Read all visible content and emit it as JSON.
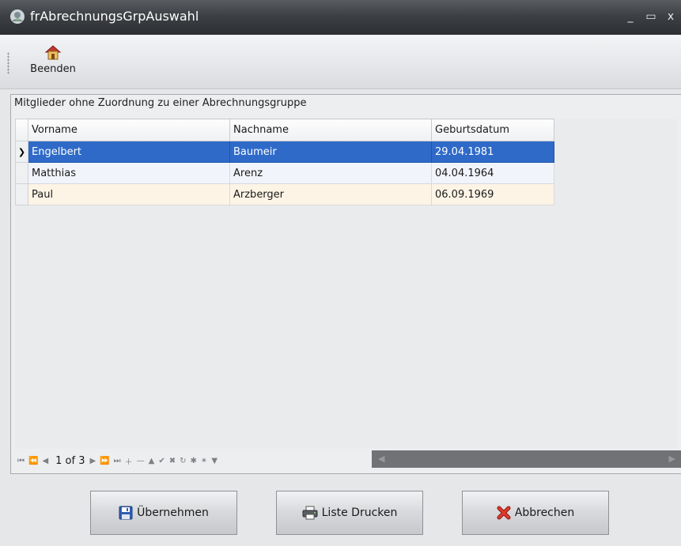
{
  "window": {
    "title": "frAbrechnungsGrpAuswahl",
    "minimize_label": "_",
    "maximize_label": "▭",
    "close_label": "x"
  },
  "toolbar": {
    "exit_label": "Beenden",
    "exit_icon": "house-icon"
  },
  "group": {
    "caption": "Mitglieder ohne Zuordnung zu einer Abrechnungsgruppe"
  },
  "grid": {
    "columns": [
      "Vorname",
      "Nachname",
      "Geburtsdatum"
    ],
    "rows": [
      {
        "vorname": "Engelbert",
        "nachname": "Baumeir",
        "geburtsdatum": "29.04.1981",
        "selected": true
      },
      {
        "vorname": "Matthias",
        "nachname": "Arenz",
        "geburtsdatum": "04.04.1964"
      },
      {
        "vorname": "Paul",
        "nachname": "Arzberger",
        "geburtsdatum": "06.09.1969"
      }
    ],
    "selection_color": "#2f6ac9"
  },
  "navigator": {
    "position": "1 of 3"
  },
  "buttons": {
    "apply_label": "Übernehmen",
    "print_label": "Liste Drucken",
    "cancel_label": "Abbrechen"
  }
}
